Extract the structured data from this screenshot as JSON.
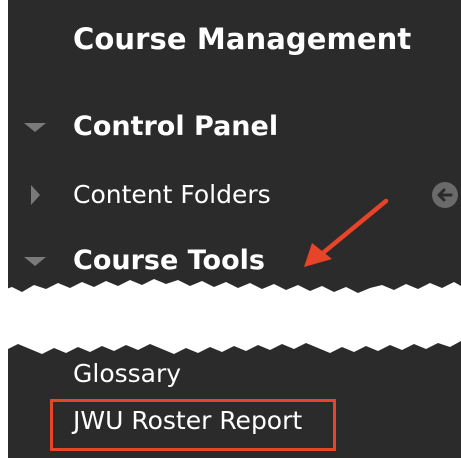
{
  "menu": {
    "heading": "Course Management",
    "items": [
      {
        "label": "Control Panel",
        "expanded": true
      },
      {
        "label": "Content Folders",
        "expanded": false
      },
      {
        "label": "Course Tools",
        "expanded": true
      }
    ],
    "subitems": [
      {
        "label": "Glossary"
      },
      {
        "label": "JWU Roster Report"
      }
    ]
  },
  "icons": {
    "expanded": "triangle-down-icon",
    "collapsed": "triangle-right-icon",
    "expand_panel": "circle-arrow-left-icon"
  },
  "colors": {
    "panel_background": "#2b2b2b",
    "text": "#ffffff",
    "triangle": "#7a7a7a",
    "annotation": "#e8442a"
  }
}
